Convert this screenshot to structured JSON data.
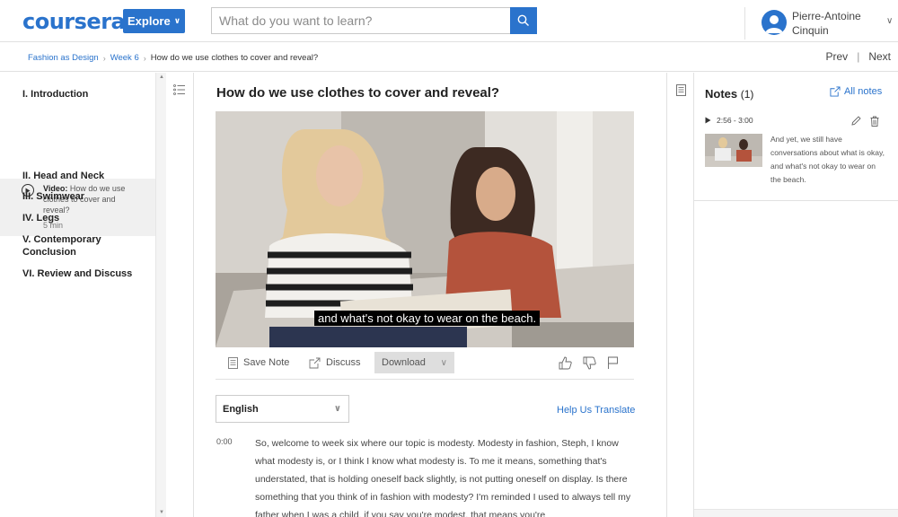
{
  "header": {
    "logo": "coursera",
    "explore_label": "Explore",
    "search_placeholder": "What do you want to learn?",
    "user_name": "Pierre-Antoine Cinquin"
  },
  "breadcrumb": {
    "items": [
      "Fashion as Design",
      "Week 6"
    ],
    "current": "How do we use clothes to cover and reveal?",
    "prev": "Prev",
    "next": "Next"
  },
  "sidebar": {
    "items": [
      {
        "label": "I. Introduction"
      },
      {
        "label": "II. Head and Neck"
      },
      {
        "label": "III. Swimwear"
      },
      {
        "label": "IV. Legs"
      },
      {
        "label": "V. Contemporary Conclusion"
      },
      {
        "label": "VI. Review and Discuss"
      }
    ],
    "active_video": {
      "prefix": "Video:",
      "title": "How do we use clothes to cover and reveal?",
      "duration": "5 min"
    }
  },
  "main": {
    "title": "How do we use clothes to cover and reveal?",
    "caption": "and what's not okay to wear on the beach.",
    "toolbar": {
      "save_note": "Save Note",
      "discuss": "Discuss",
      "download": "Download"
    },
    "language": "English",
    "help_translate": "Help Us Translate",
    "transcript": {
      "timestamp": "0:00",
      "text": "So, welcome to week six where our topic is modesty. Modesty in fashion, Steph, I know what modesty is, or I think I know what modesty is. To me it means, something that's understated, that is holding oneself back slightly, is not putting oneself on display. Is there something that you think of in fashion with modesty? I'm reminded I used to always tell my father when I was a child, if you say you're modest, that means you're"
    }
  },
  "notes": {
    "title": "Notes",
    "count": "(1)",
    "all_notes": "All notes",
    "items": [
      {
        "time": "2:56 - 3:00",
        "text": "And yet, we still have conversations about what is okay, and what's not okay to wear on the beach."
      }
    ]
  },
  "colors": {
    "brand_blue": "#2a73cc"
  }
}
